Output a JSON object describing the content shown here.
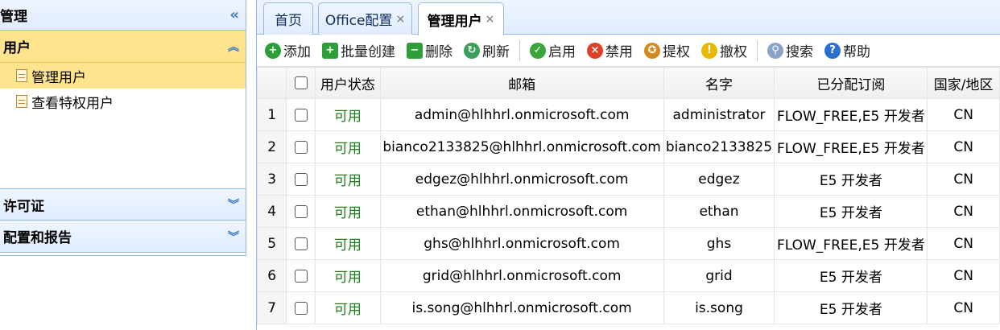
{
  "left_panel": {
    "title": "管理",
    "collapse_glyph": "«",
    "groups": [
      {
        "label": "用户",
        "arrow": "︽",
        "items": [
          {
            "label": "管理用户"
          },
          {
            "label": "查看特权用户"
          }
        ]
      },
      {
        "label": "许可证",
        "arrow": "︾"
      },
      {
        "label": "配置和报告",
        "arrow": "︾"
      }
    ]
  },
  "tabs": [
    {
      "label": "首页"
    },
    {
      "label": "Office配置",
      "close": "×"
    },
    {
      "label": "管理用户",
      "close": "×"
    }
  ],
  "toolbar": [
    {
      "label": "添加",
      "icon": "add-icon",
      "color": "#2e9e3a"
    },
    {
      "label": "批量创建",
      "icon": "batch-add-icon",
      "color": "#2e9e3a"
    },
    {
      "label": "删除",
      "icon": "delete-icon",
      "color": "#2e9e3a"
    },
    {
      "label": "刷新",
      "icon": "refresh-icon",
      "color": "#3aa05a"
    },
    {
      "label": "启用",
      "icon": "enable-icon",
      "color": "#3aa53a"
    },
    {
      "label": "禁用",
      "icon": "disable-icon",
      "color": "#e0402a"
    },
    {
      "label": "提权",
      "icon": "medal-icon",
      "color": "#d08a20"
    },
    {
      "label": "撤权",
      "icon": "warning-icon",
      "color": "#e6b800"
    },
    {
      "label": "搜索",
      "icon": "search-icon",
      "color": "#8aa4c8"
    },
    {
      "label": "帮助",
      "icon": "help-icon",
      "color": "#2a6fd0"
    }
  ],
  "table": {
    "columns": [
      "用户状态",
      "邮箱",
      "名字",
      "已分配订阅",
      "国家/地区"
    ],
    "rows": [
      {
        "n": "1",
        "status": "可用",
        "email": "admin@hlhhrl.onmicrosoft.com",
        "name": "administrator",
        "sub": "FLOW_FREE,E5 开发者",
        "country": "CN"
      },
      {
        "n": "2",
        "status": "可用",
        "email": "bianco2133825@hlhhrl.onmicrosoft.com",
        "name": "bianco2133825",
        "sub": "FLOW_FREE,E5 开发者",
        "country": "CN"
      },
      {
        "n": "3",
        "status": "可用",
        "email": "edgez@hlhhrl.onmicrosoft.com",
        "name": "edgez",
        "sub": "E5 开发者",
        "country": "CN"
      },
      {
        "n": "4",
        "status": "可用",
        "email": "ethan@hlhhrl.onmicrosoft.com",
        "name": "ethan",
        "sub": "E5 开发者",
        "country": "CN"
      },
      {
        "n": "5",
        "status": "可用",
        "email": "ghs@hlhhrl.onmicrosoft.com",
        "name": "ghs",
        "sub": "FLOW_FREE,E5 开发者",
        "country": "CN"
      },
      {
        "n": "6",
        "status": "可用",
        "email": "grid@hlhhrl.onmicrosoft.com",
        "name": "grid",
        "sub": "E5 开发者",
        "country": "CN"
      },
      {
        "n": "7",
        "status": "可用",
        "email": "is.song@hlhhrl.onmicrosoft.com",
        "name": "is.song",
        "sub": "E5 开发者",
        "country": "CN"
      }
    ]
  }
}
